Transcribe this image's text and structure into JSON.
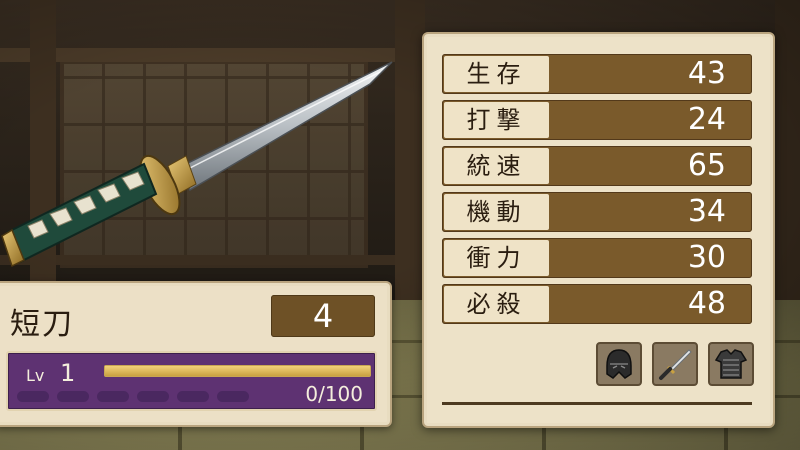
{
  "weapon": {
    "name": "短刀",
    "count": "4",
    "level_label": "Lv",
    "level": "1",
    "xp_text": "0/100",
    "xp_progress": 0.0
  },
  "stats": [
    {
      "label": "生存",
      "value": "43"
    },
    {
      "label": "打撃",
      "value": "24"
    },
    {
      "label": "統速",
      "value": "65"
    },
    {
      "label": "機動",
      "value": "34"
    },
    {
      "label": "衝力",
      "value": "30"
    },
    {
      "label": "必殺",
      "value": "48"
    }
  ],
  "equipment": [
    {
      "icon": "helmet-icon"
    },
    {
      "icon": "dagger-icon"
    },
    {
      "icon": "armor-icon"
    }
  ],
  "colors": {
    "panel": "#ede2c8",
    "stat_bar": "#7a5a2b",
    "level_box": "#5e3272",
    "xp_bar": "#c9a141"
  }
}
